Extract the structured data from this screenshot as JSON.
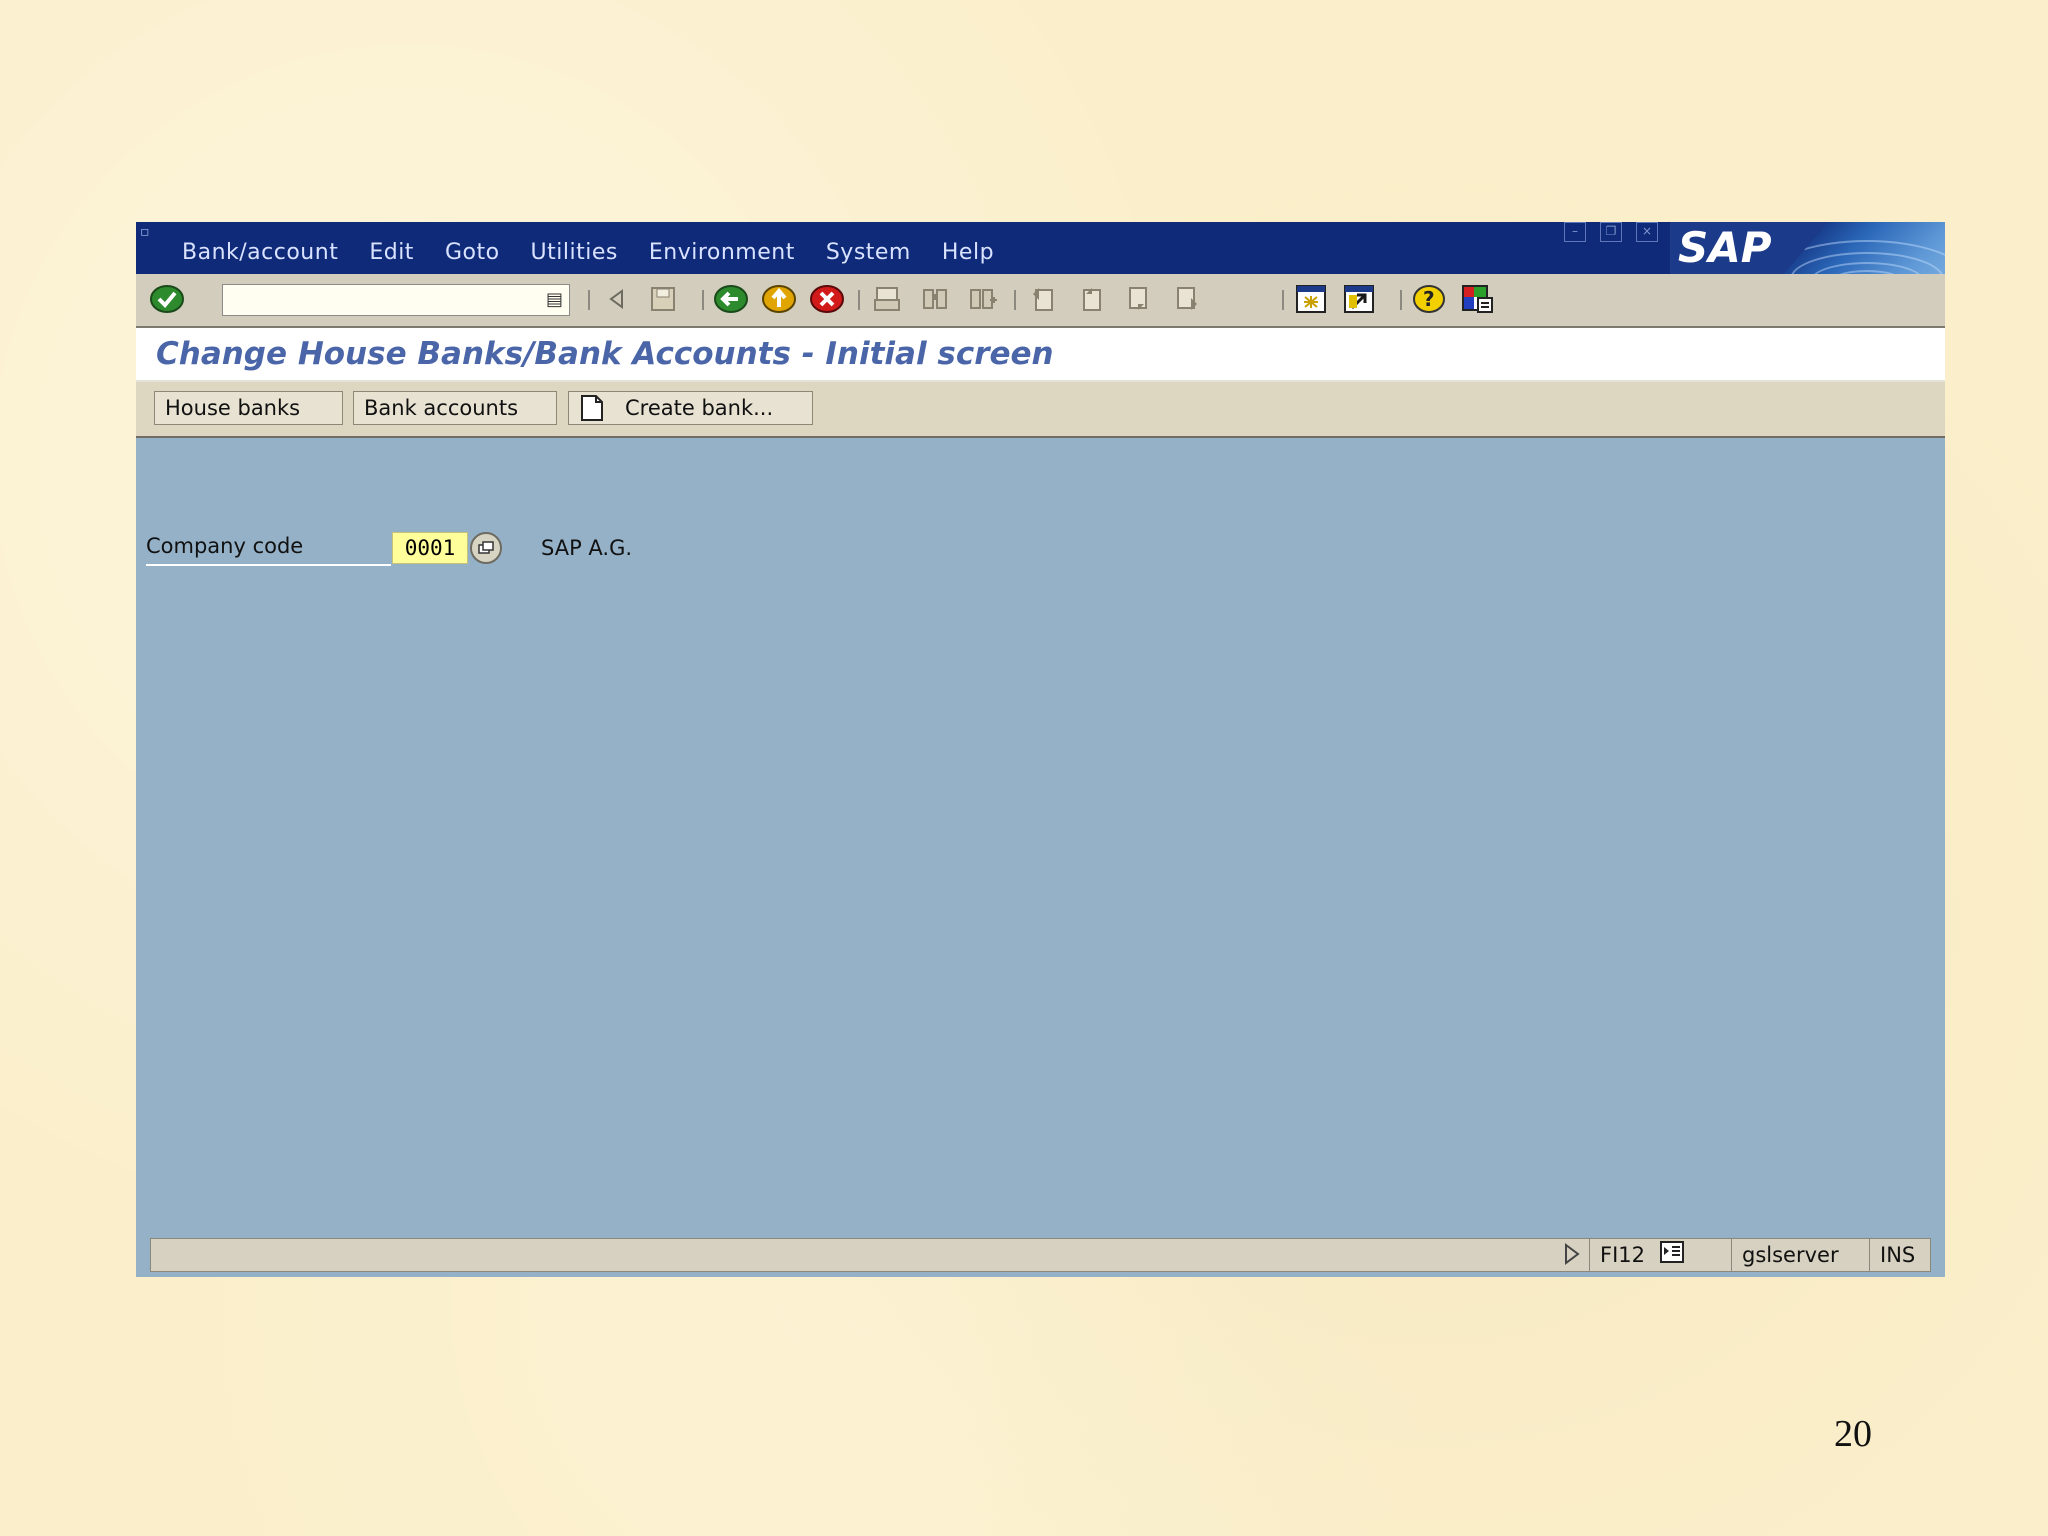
{
  "menubar": {
    "items": [
      {
        "label": "Bank/account"
      },
      {
        "label": "Edit"
      },
      {
        "label": "Goto"
      },
      {
        "label": "Utilities"
      },
      {
        "label": "Environment"
      },
      {
        "label": "System"
      },
      {
        "label": "Help"
      }
    ],
    "brand": "SAP"
  },
  "toolbar": {
    "command_field_value": "",
    "icons": [
      "enter-icon",
      "back-nav-icon",
      "save-icon",
      "back-icon",
      "exit-icon",
      "cancel-icon",
      "print-icon",
      "find-icon",
      "find-next-icon",
      "first-page-icon",
      "previous-page-icon",
      "next-page-icon",
      "last-page-icon",
      "create-session-icon",
      "shortcut-icon",
      "help-icon",
      "customize-layout-icon"
    ]
  },
  "title": "Change House Banks/Bank Accounts - Initial screen",
  "app_toolbar": {
    "house_banks": "House banks",
    "bank_accounts": "Bank accounts",
    "create_bank": "Create bank..."
  },
  "form": {
    "company_code_label": "Company code",
    "company_code_value": "0001",
    "company_name": "SAP A.G."
  },
  "status": {
    "transaction": "FI12",
    "server": "gslserver",
    "mode": "INS"
  },
  "slide_number": "20",
  "colors": {
    "menubar": "#0f2a78",
    "window_bg": "#94b1c7",
    "title_text": "#4a66a8",
    "required_field": "#fffe9a"
  }
}
